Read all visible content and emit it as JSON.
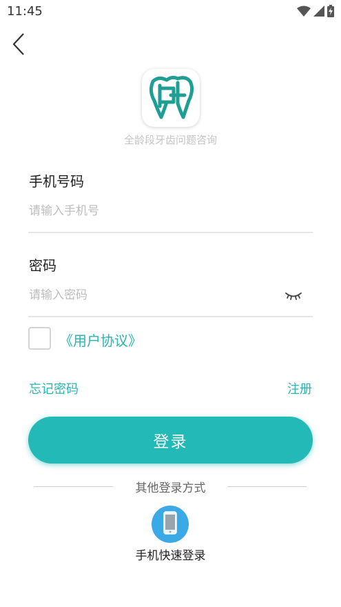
{
  "status_bar": {
    "time": "11:45",
    "icons": [
      "wifi-icon",
      "signal-icon",
      "battery-charging-icon"
    ]
  },
  "header": {
    "back_icon": "chevron-left-icon"
  },
  "brand": {
    "logo_icon": "tooth-logo-icon",
    "tagline": "全龄段牙齿问题咨询"
  },
  "form": {
    "phone": {
      "label": "手机号码",
      "value": "",
      "placeholder": "请输入手机号"
    },
    "password": {
      "label": "密码",
      "value": "",
      "placeholder": "请输入密码",
      "toggle_icon": "eye-closed-icon"
    },
    "agreement": {
      "checked": false,
      "link_text": "《用户协议》"
    },
    "forgot_password": "忘记密码",
    "register": "注册",
    "login_button": "登录"
  },
  "other_login": {
    "title": "其他登录方式",
    "quick_login": {
      "icon": "mobile-phone-icon",
      "label": "手机快速登录"
    }
  },
  "colors": {
    "accent": "#22b9b6",
    "link": "#27b5b2",
    "quick_login_icon_bg": "#3ba9e6"
  }
}
